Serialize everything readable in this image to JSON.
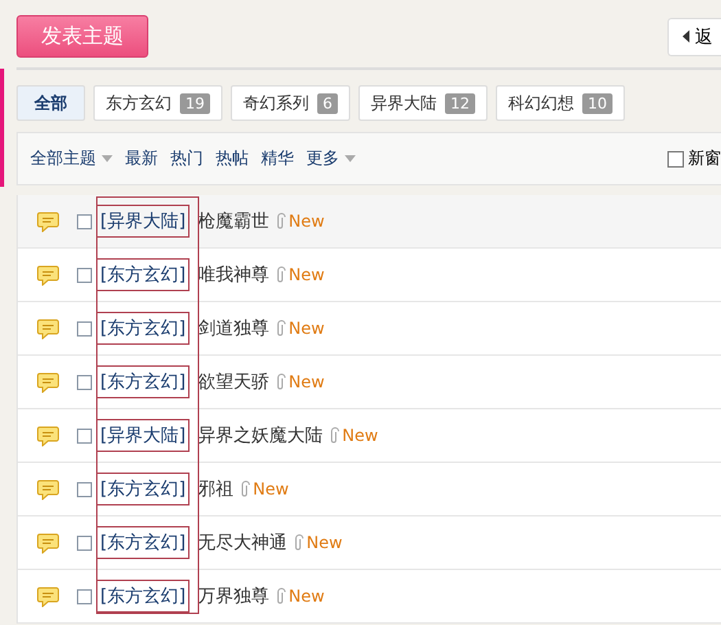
{
  "post_button": {
    "label": "发表主题"
  },
  "back_button": {
    "label": "返"
  },
  "category_tabs": [
    {
      "label": "全部",
      "selected": true
    },
    {
      "label": "东方玄幻",
      "count": "19",
      "selected": false
    },
    {
      "label": "奇幻系列",
      "count": "6",
      "selected": false
    },
    {
      "label": "异界大陆",
      "count": "12",
      "selected": false
    },
    {
      "label": "科幻幻想",
      "count": "10",
      "selected": false
    }
  ],
  "filter_bar": {
    "links": [
      {
        "label": "全部主题",
        "dropdown": true
      },
      {
        "label": "最新",
        "dropdown": false
      },
      {
        "label": "热门",
        "dropdown": false
      },
      {
        "label": "热帖",
        "dropdown": false
      },
      {
        "label": "精华",
        "dropdown": false
      },
      {
        "label": "更多",
        "dropdown": true
      }
    ],
    "new_window": {
      "label": "新窗",
      "checked": false
    }
  },
  "threads": [
    {
      "category": "[异界大陆]",
      "title": "枪魔霸世",
      "badge": "New",
      "checked": false
    },
    {
      "category": "[东方玄幻]",
      "title": "唯我神尊",
      "badge": "New",
      "checked": false
    },
    {
      "category": "[东方玄幻]",
      "title": "剑道独尊",
      "badge": "New",
      "checked": false
    },
    {
      "category": "[东方玄幻]",
      "title": "欲望天骄",
      "badge": "New",
      "checked": false
    },
    {
      "category": "[异界大陆]",
      "title": "异界之妖魔大陆",
      "badge": "New",
      "checked": false
    },
    {
      "category": "[东方玄幻]",
      "title": "邪祖",
      "badge": "New",
      "checked": false
    },
    {
      "category": "[东方玄幻]",
      "title": "无尽大神通",
      "badge": "New",
      "checked": false
    },
    {
      "category": "[东方玄幻]",
      "title": "万界独尊",
      "badge": "New",
      "checked": false
    }
  ]
}
